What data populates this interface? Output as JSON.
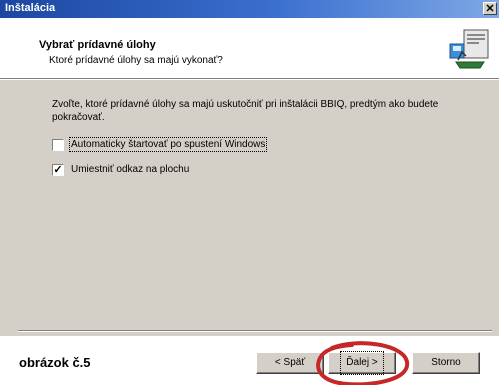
{
  "window": {
    "title": "Inštalácia",
    "close_glyph": "✕"
  },
  "header": {
    "title": "Vybrať prídavné úlohy",
    "subtitle": "Ktoré prídavné úlohy sa majú vykonať?",
    "icon": "install-wizard-icon"
  },
  "main": {
    "description": "Zvoľte, ktoré prídavné úlohy sa majú uskutočniť pri inštalácii BBIQ, predtým ako budete pokračovať.",
    "options": [
      {
        "label": "Automaticky štartovať po spustení Windows",
        "checked": false,
        "check_glyph": ""
      },
      {
        "label": "Umiestniť odkaz na plochu",
        "checked": true,
        "check_glyph": "✓"
      }
    ]
  },
  "caption": "obrázok č.5",
  "buttons": {
    "back": "< Späť",
    "next": "Ďalej >",
    "cancel": "Storno"
  },
  "colors": {
    "titlebar": "#1c47a0",
    "annotation": "#c62828",
    "dialog_bg": "#d4d0c8"
  }
}
